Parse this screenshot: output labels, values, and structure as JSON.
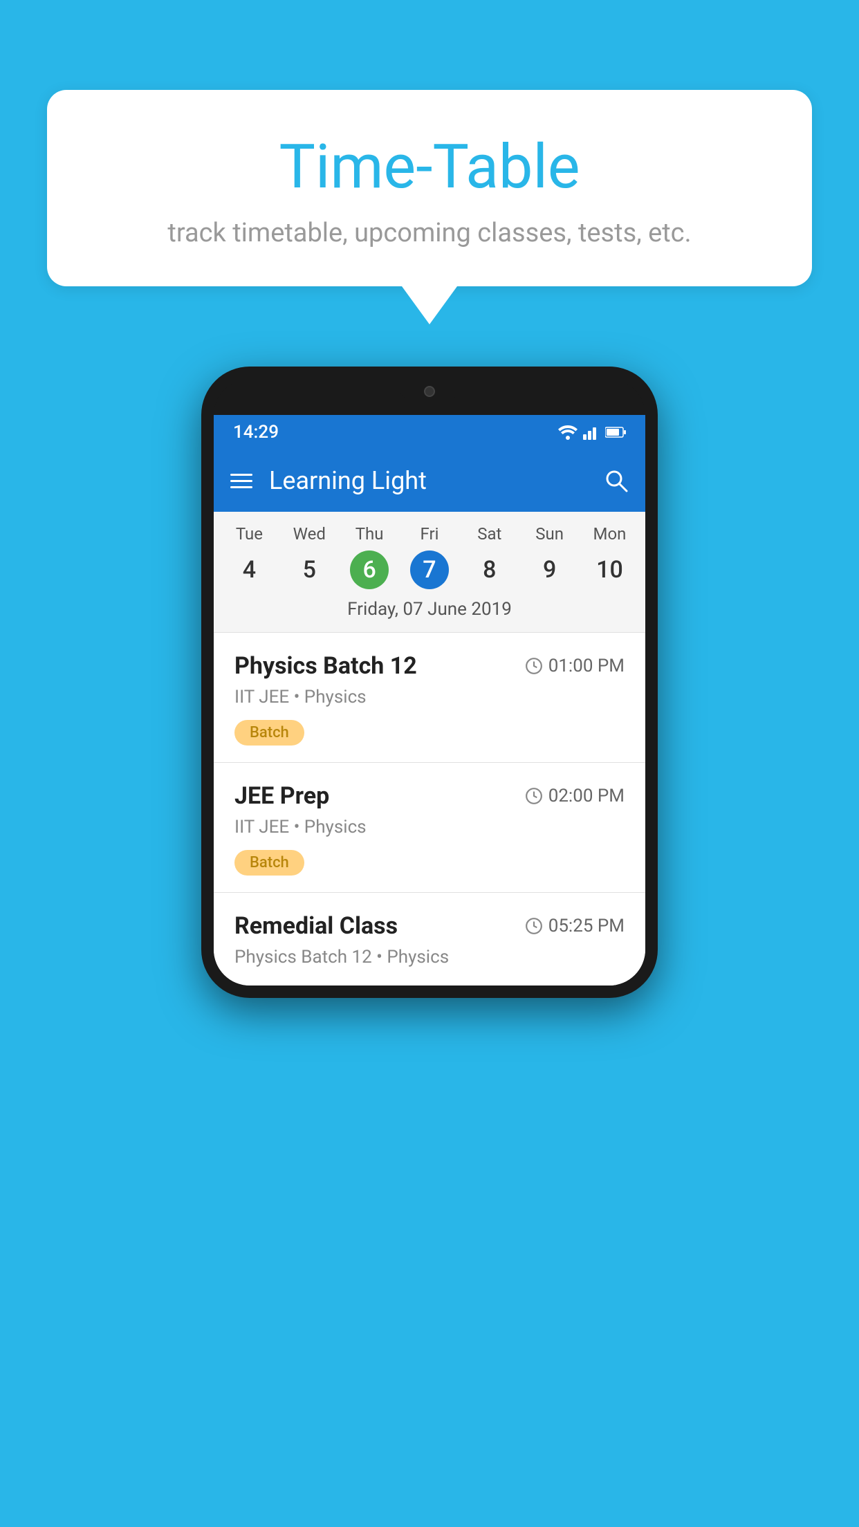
{
  "background": {
    "color": "#29b6e8"
  },
  "speechBubble": {
    "title": "Time-Table",
    "subtitle": "track timetable, upcoming classes, tests, etc."
  },
  "phone": {
    "statusBar": {
      "time": "14:29",
      "icons": [
        "wifi",
        "signal",
        "battery"
      ]
    },
    "toolbar": {
      "title": "Learning Light",
      "menuLabel": "menu",
      "searchLabel": "search"
    },
    "calendar": {
      "days": [
        {
          "name": "Tue",
          "number": "4",
          "state": "normal"
        },
        {
          "name": "Wed",
          "number": "5",
          "state": "normal"
        },
        {
          "name": "Thu",
          "number": "6",
          "state": "today"
        },
        {
          "name": "Fri",
          "number": "7",
          "state": "selected"
        },
        {
          "name": "Sat",
          "number": "8",
          "state": "normal"
        },
        {
          "name": "Sun",
          "number": "9",
          "state": "normal"
        },
        {
          "name": "Mon",
          "number": "10",
          "state": "normal"
        }
      ],
      "selectedDate": "Friday, 07 June 2019"
    },
    "schedule": [
      {
        "title": "Physics Batch 12",
        "time": "01:00 PM",
        "subtitle": "IIT JEE • Physics",
        "badge": "Batch"
      },
      {
        "title": "JEE Prep",
        "time": "02:00 PM",
        "subtitle": "IIT JEE • Physics",
        "badge": "Batch"
      },
      {
        "title": "Remedial Class",
        "time": "05:25 PM",
        "subtitle": "Physics Batch 12 • Physics",
        "badge": null
      }
    ]
  }
}
